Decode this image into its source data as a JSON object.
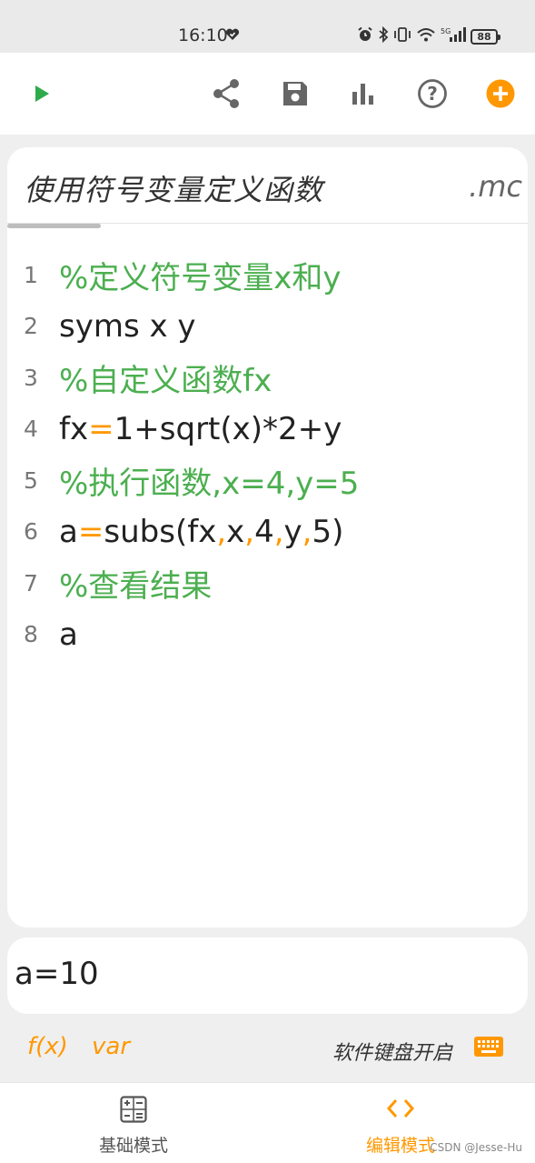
{
  "status_bar": {
    "time": "16:10",
    "battery": "88",
    "icons": [
      "heart-icon",
      "alarm-icon",
      "bluetooth-icon",
      "vibrate-icon",
      "wifi-icon",
      "signal-5g-icon",
      "battery-icon"
    ]
  },
  "toolbar": {
    "icons": [
      "run-icon",
      "share-icon",
      "save-icon",
      "chart-icon",
      "help-icon",
      "add-icon"
    ]
  },
  "file": {
    "title": "使用符号变量定义函数",
    "ext": ".mc"
  },
  "code_lines": [
    {
      "no": "1",
      "text": "%定义符号变量x和y"
    },
    {
      "no": "2",
      "text": "syms x y"
    },
    {
      "no": "3",
      "text": "%自定义函数fx"
    },
    {
      "no": "4",
      "text": "fx=1+sqrt(x)*2+y"
    },
    {
      "no": "5",
      "text": "%执行函数,x=4,y=5"
    },
    {
      "no": "6",
      "text": "a=subs(fx,x,4,y,5)"
    },
    {
      "no": "7",
      "text": "%查看结果"
    },
    {
      "no": "8",
      "text": "a"
    }
  ],
  "result": {
    "text": "a=10"
  },
  "fx_row": {
    "fx_label": "f(x)",
    "var_label": "var",
    "keyboard_label": "软件键盘开启"
  },
  "bottom_nav": {
    "basic_label": "基础模式",
    "edit_label": "编辑模式",
    "active": "edit"
  },
  "watermark": "CSDN @Jesse-Hu",
  "colors": {
    "comment": "#4caf50",
    "operator": "#ff9800",
    "accent": "#ff9800",
    "run": "#2eaa4b"
  }
}
